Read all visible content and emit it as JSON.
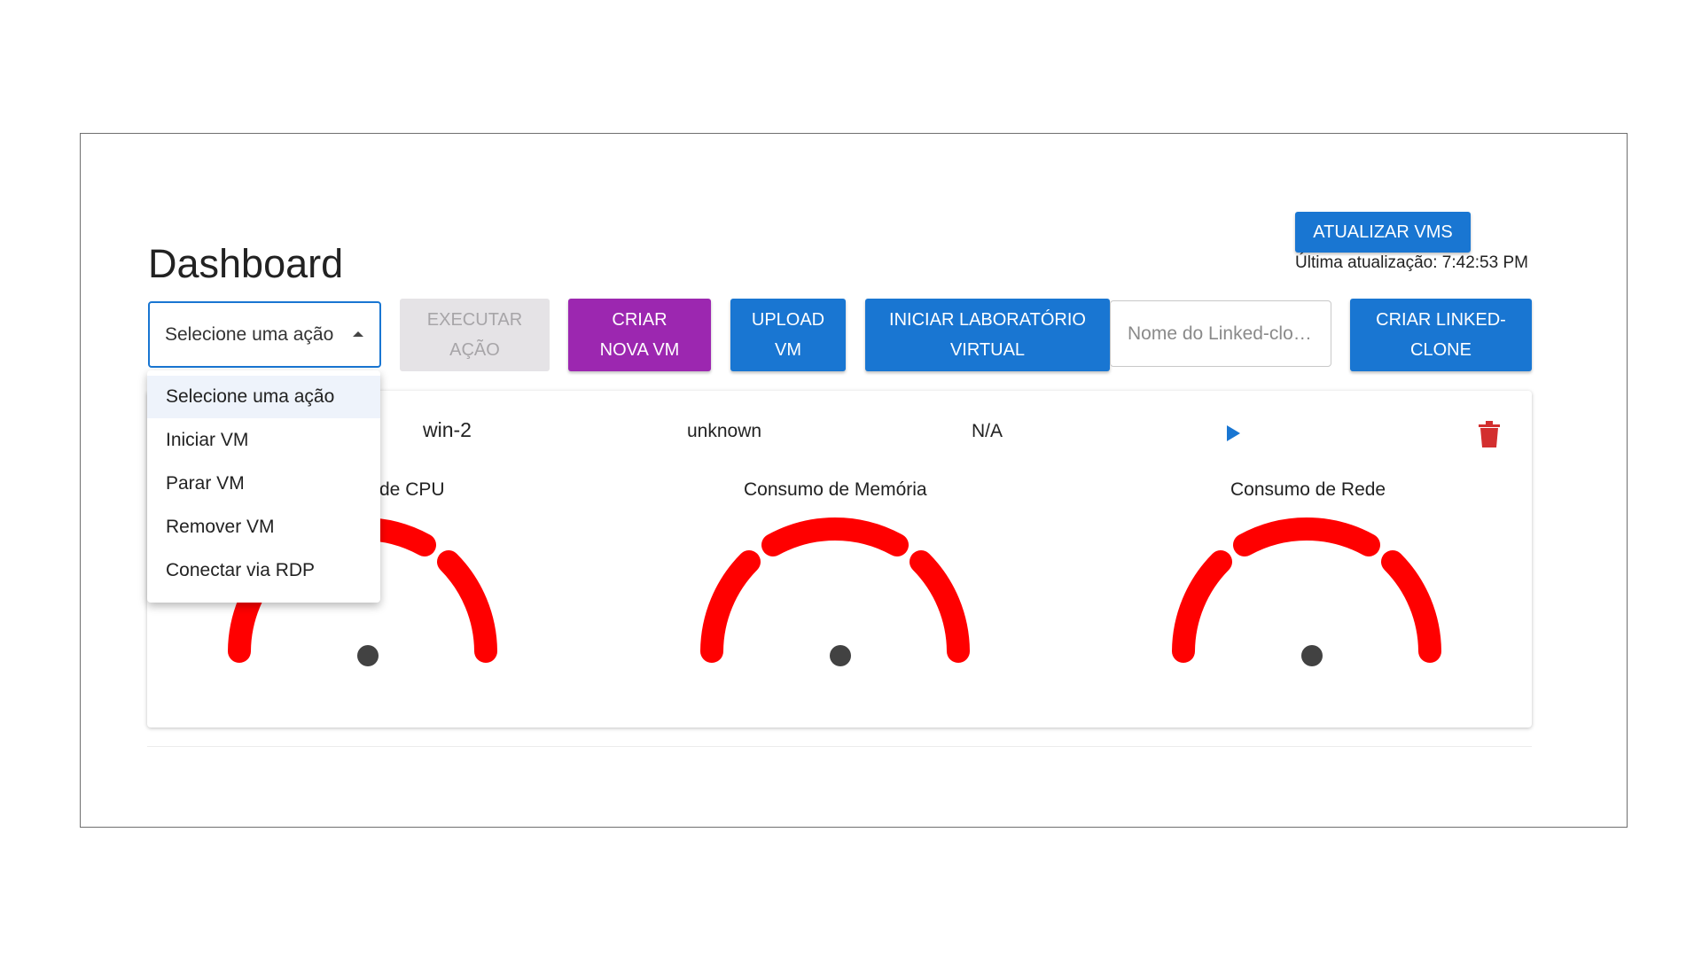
{
  "header": {
    "title": "Dashboard",
    "refresh_button": "ATUALIZAR VMS",
    "last_update": "Última atualização: 7:42:53 PM"
  },
  "toolbar": {
    "select_value": "Selecione uma ação",
    "execute_line1": "EXECUTAR",
    "execute_line2": "AÇÃO",
    "create_vm_line1": "CRIAR",
    "create_vm_line2": "NOVA VM",
    "upload_line1": "UPLOAD",
    "upload_line2": "VM",
    "lab_line1": "INICIAR LABORATÓRIO",
    "lab_line2": "VIRTUAL",
    "linked_clone_placeholder": "Nome do Linked-clo…",
    "create_linked_line1": "CRIAR LINKED-",
    "create_linked_line2": "CLONE"
  },
  "vm": {
    "name": "win-2",
    "status": "unknown",
    "ip": "N/A"
  },
  "gauges": [
    {
      "label": "de CPU"
    },
    {
      "label": "Consumo de Memória"
    },
    {
      "label": "Consumo de Rede"
    }
  ],
  "dropdown": {
    "options": [
      "Selecione uma ação",
      "Iniciar VM",
      "Parar VM",
      "Remover VM",
      "Conectar via RDP"
    ]
  },
  "icons": {
    "select_caret": "caret-up-icon",
    "start": "play-icon",
    "delete": "trash-icon"
  },
  "colors": {
    "primary": "#1976d2",
    "secondary": "#9c27b0",
    "gauge": "#ff0000",
    "danger": "#d32f2f"
  }
}
